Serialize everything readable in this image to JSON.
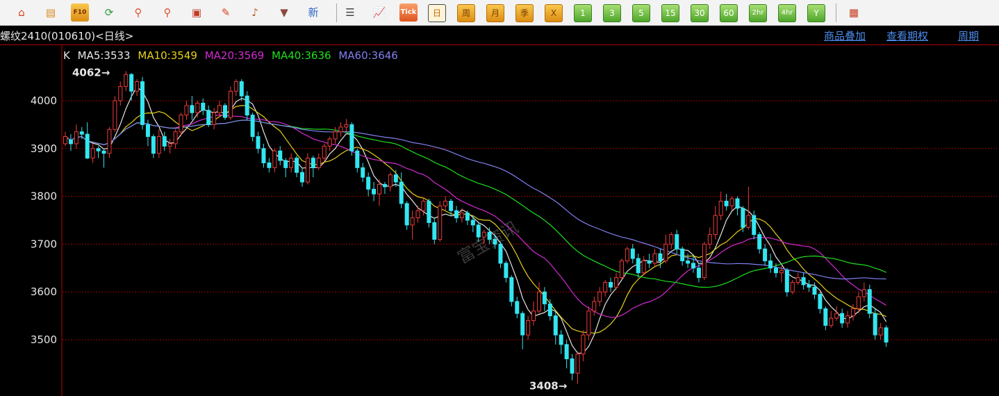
{
  "toolbar": {
    "tools": [
      {
        "icon": "home-icon",
        "glyph": "⌂",
        "color": "#d8411d"
      },
      {
        "icon": "notes-icon",
        "glyph": "▤",
        "color": "#d9871a"
      },
      {
        "icon": "f10-icon",
        "label": "F10"
      },
      {
        "icon": "refresh-icon",
        "glyph": "⟳",
        "color": "#2e9c3a"
      },
      {
        "icon": "zoom-in-icon",
        "glyph": "⚲",
        "color": "#e0512a"
      },
      {
        "icon": "zoom-out-icon",
        "glyph": "⚲",
        "color": "#e0512a"
      },
      {
        "icon": "windows-icon",
        "glyph": "▣",
        "color": "#c23a21"
      },
      {
        "icon": "pen-icon",
        "glyph": "✎",
        "color": "#d9421f"
      },
      {
        "icon": "bell-icon",
        "glyph": "♪",
        "color": "#b3602a"
      },
      {
        "icon": "filter-icon",
        "glyph": "▼",
        "color": "#8b4a3b"
      },
      {
        "icon": "news-icon",
        "label": "新",
        "color": "#2f66c5"
      }
    ],
    "tools2": [
      {
        "icon": "table-icon",
        "glyph": "☰",
        "color": "#444444"
      },
      {
        "icon": "line-chart-icon",
        "glyph": "📈",
        "color": "#c73a20"
      },
      {
        "icon": "tick-icon",
        "label": "Tick"
      }
    ],
    "periods": [
      {
        "label": "日",
        "style": "sel"
      },
      {
        "label": "周",
        "style": "amber"
      },
      {
        "label": "月",
        "style": "amber"
      },
      {
        "label": "季",
        "style": "amber"
      },
      {
        "label": "X",
        "style": "amber"
      },
      {
        "label": "1",
        "style": "green"
      },
      {
        "label": "3",
        "style": "green"
      },
      {
        "label": "5",
        "style": "green"
      },
      {
        "label": "15",
        "style": "green"
      },
      {
        "label": "30",
        "style": "green"
      },
      {
        "label": "60",
        "style": "green"
      },
      {
        "label": "2hr",
        "style": "green"
      },
      {
        "label": "4hr",
        "style": "green"
      },
      {
        "label": "Y",
        "style": "green"
      }
    ],
    "last_tool": {
      "icon": "grid-icon",
      "glyph": "▦",
      "color": "#c63a1c"
    }
  },
  "header": {
    "instrument": "螺纹2410(010610)<日线>",
    "links": [
      "商品叠加",
      "查看期权",
      "周期"
    ]
  },
  "legend": [
    {
      "label": "K",
      "color": "#e8e8e8"
    },
    {
      "label": "MA5:3533",
      "color": "#e8e8e8"
    },
    {
      "label": "MA10:3549",
      "color": "#e6d21a"
    },
    {
      "label": "MA20:3569",
      "color": "#d22bd2"
    },
    {
      "label": "MA40:3636",
      "color": "#1ee01e"
    },
    {
      "label": "MA60:3646",
      "color": "#8080f0"
    }
  ],
  "chart_data": {
    "type": "candlestick",
    "ylim": [
      3400,
      4100
    ],
    "yticks": [
      3500,
      3600,
      3700,
      3800,
      3900,
      4000
    ],
    "grid": true,
    "watermark": "富宝资讯",
    "annotations": [
      {
        "text": "4062→",
        "value": 4062
      },
      {
        "text": "3408→",
        "value": 3408
      }
    ],
    "up_color": "#f03c3c",
    "down_color": "#33e6f0",
    "candles": [
      [
        3910,
        3925,
        3935,
        3905
      ],
      [
        3918,
        3910,
        3930,
        3895
      ],
      [
        3910,
        3935,
        3950,
        3900
      ],
      [
        3935,
        3930,
        3945,
        3920
      ],
      [
        3930,
        3880,
        3955,
        3878
      ],
      [
        3880,
        3900,
        3910,
        3870
      ],
      [
        3900,
        3895,
        3905,
        3880
      ],
      [
        3895,
        3890,
        3900,
        3860
      ],
      [
        3890,
        3940,
        3945,
        3880
      ],
      [
        3940,
        4000,
        4010,
        3935
      ],
      [
        4000,
        4030,
        4040,
        3990
      ],
      [
        4030,
        4055,
        4062,
        4020
      ],
      [
        4055,
        4020,
        4058,
        4000
      ],
      [
        4020,
        4040,
        4045,
        4010
      ],
      [
        4040,
        3950,
        4050,
        3940
      ],
      [
        3950,
        3925,
        3960,
        3905
      ],
      [
        3925,
        3890,
        3930,
        3880
      ],
      [
        3890,
        3925,
        3940,
        3880
      ],
      [
        3925,
        3905,
        3935,
        3895
      ],
      [
        3905,
        3910,
        3920,
        3890
      ],
      [
        3910,
        3935,
        3940,
        3900
      ],
      [
        3935,
        3970,
        3975,
        3925
      ],
      [
        3970,
        3990,
        4000,
        3960
      ],
      [
        3990,
        3975,
        4010,
        3960
      ],
      [
        3975,
        3995,
        4000,
        3965
      ],
      [
        3995,
        3980,
        4005,
        3970
      ],
      [
        3980,
        3950,
        3990,
        3945
      ],
      [
        3950,
        3975,
        3985,
        3940
      ],
      [
        3975,
        3990,
        4000,
        3965
      ],
      [
        3990,
        3965,
        3995,
        3960
      ],
      [
        3965,
        4020,
        4030,
        3960
      ],
      [
        4020,
        4040,
        4045,
        4010
      ],
      [
        4040,
        4010,
        4045,
        4000
      ],
      [
        4010,
        3970,
        4020,
        3960
      ],
      [
        3970,
        3925,
        3975,
        3915
      ],
      [
        3925,
        3900,
        3935,
        3890
      ],
      [
        3900,
        3870,
        3910,
        3860
      ],
      [
        3870,
        3860,
        3880,
        3850
      ],
      [
        3860,
        3895,
        3900,
        3850
      ],
      [
        3895,
        3875,
        3905,
        3865
      ],
      [
        3875,
        3860,
        3880,
        3840
      ],
      [
        3860,
        3880,
        3890,
        3850
      ],
      [
        3880,
        3850,
        3885,
        3840
      ],
      [
        3850,
        3830,
        3860,
        3820
      ],
      [
        3830,
        3880,
        3890,
        3825
      ],
      [
        3880,
        3860,
        3885,
        3840
      ],
      [
        3860,
        3880,
        3890,
        3855
      ],
      [
        3880,
        3905,
        3910,
        3870
      ],
      [
        3905,
        3920,
        3925,
        3895
      ],
      [
        3920,
        3935,
        3945,
        3910
      ],
      [
        3935,
        3945,
        3955,
        3925
      ],
      [
        3945,
        3950,
        3962,
        3935
      ],
      [
        3950,
        3895,
        3955,
        3885
      ],
      [
        3895,
        3860,
        3900,
        3850
      ],
      [
        3860,
        3840,
        3870,
        3830
      ],
      [
        3840,
        3815,
        3850,
        3800
      ],
      [
        3815,
        3805,
        3830,
        3790
      ],
      [
        3805,
        3825,
        3835,
        3780
      ],
      [
        3825,
        3820,
        3830,
        3805
      ],
      [
        3820,
        3845,
        3850,
        3810
      ],
      [
        3845,
        3830,
        3855,
        3820
      ],
      [
        3830,
        3785,
        3850,
        3775
      ],
      [
        3785,
        3740,
        3790,
        3730
      ],
      [
        3740,
        3755,
        3770,
        3710
      ],
      [
        3755,
        3770,
        3780,
        3745
      ],
      [
        3770,
        3790,
        3795,
        3760
      ],
      [
        3790,
        3745,
        3795,
        3735
      ],
      [
        3745,
        3710,
        3755,
        3700
      ],
      [
        3710,
        3780,
        3790,
        3705
      ],
      [
        3780,
        3790,
        3800,
        3770
      ],
      [
        3790,
        3770,
        3795,
        3760
      ],
      [
        3770,
        3755,
        3780,
        3745
      ],
      [
        3755,
        3765,
        3775,
        3745
      ],
      [
        3765,
        3750,
        3770,
        3740
      ],
      [
        3750,
        3740,
        3760,
        3725
      ],
      [
        3740,
        3715,
        3745,
        3705
      ],
      [
        3715,
        3725,
        3730,
        3700
      ],
      [
        3725,
        3710,
        3735,
        3700
      ],
      [
        3710,
        3700,
        3720,
        3690
      ],
      [
        3700,
        3660,
        3705,
        3650
      ],
      [
        3660,
        3630,
        3665,
        3620
      ],
      [
        3630,
        3580,
        3635,
        3570
      ],
      [
        3580,
        3555,
        3590,
        3545
      ],
      [
        3555,
        3510,
        3560,
        3480
      ],
      [
        3510,
        3540,
        3550,
        3500
      ],
      [
        3540,
        3560,
        3580,
        3530
      ],
      [
        3560,
        3600,
        3620,
        3555
      ],
      [
        3600,
        3575,
        3610,
        3560
      ],
      [
        3575,
        3550,
        3585,
        3540
      ],
      [
        3550,
        3510,
        3560,
        3490
      ],
      [
        3510,
        3490,
        3520,
        3470
      ],
      [
        3490,
        3460,
        3500,
        3440
      ],
      [
        3460,
        3430,
        3470,
        3415
      ],
      [
        3430,
        3470,
        3475,
        3408
      ],
      [
        3470,
        3510,
        3520,
        3455
      ],
      [
        3510,
        3560,
        3570,
        3500
      ],
      [
        3560,
        3580,
        3590,
        3550
      ],
      [
        3580,
        3600,
        3610,
        3570
      ],
      [
        3600,
        3620,
        3625,
        3590
      ],
      [
        3620,
        3610,
        3630,
        3600
      ],
      [
        3610,
        3630,
        3640,
        3605
      ],
      [
        3630,
        3665,
        3670,
        3625
      ],
      [
        3665,
        3690,
        3695,
        3660
      ],
      [
        3690,
        3670,
        3700,
        3660
      ],
      [
        3670,
        3640,
        3680,
        3630
      ],
      [
        3640,
        3665,
        3675,
        3635
      ],
      [
        3665,
        3660,
        3680,
        3650
      ],
      [
        3660,
        3680,
        3690,
        3655
      ],
      [
        3680,
        3665,
        3690,
        3650
      ],
      [
        3665,
        3700,
        3720,
        3660
      ],
      [
        3700,
        3720,
        3725,
        3690
      ],
      [
        3720,
        3690,
        3730,
        3680
      ],
      [
        3690,
        3665,
        3695,
        3655
      ],
      [
        3665,
        3660,
        3680,
        3650
      ],
      [
        3660,
        3650,
        3675,
        3640
      ],
      [
        3650,
        3630,
        3660,
        3620
      ],
      [
        3630,
        3700,
        3705,
        3625
      ],
      [
        3700,
        3720,
        3735,
        3690
      ],
      [
        3720,
        3760,
        3780,
        3710
      ],
      [
        3760,
        3790,
        3810,
        3750
      ],
      [
        3790,
        3780,
        3805,
        3770
      ],
      [
        3780,
        3795,
        3800,
        3770
      ],
      [
        3795,
        3775,
        3800,
        3760
      ],
      [
        3775,
        3735,
        3780,
        3725
      ],
      [
        3735,
        3760,
        3820,
        3730
      ],
      [
        3760,
        3720,
        3770,
        3710
      ],
      [
        3720,
        3690,
        3725,
        3680
      ],
      [
        3690,
        3665,
        3700,
        3655
      ],
      [
        3665,
        3650,
        3680,
        3640
      ],
      [
        3650,
        3640,
        3660,
        3630
      ],
      [
        3640,
        3645,
        3655,
        3620
      ],
      [
        3645,
        3600,
        3650,
        3590
      ],
      [
        3600,
        3620,
        3625,
        3595
      ],
      [
        3620,
        3630,
        3640,
        3615
      ],
      [
        3630,
        3615,
        3640,
        3605
      ],
      [
        3615,
        3610,
        3625,
        3600
      ],
      [
        3610,
        3595,
        3620,
        3585
      ],
      [
        3595,
        3565,
        3600,
        3555
      ],
      [
        3565,
        3530,
        3570,
        3520
      ],
      [
        3530,
        3545,
        3560,
        3525
      ],
      [
        3545,
        3555,
        3570,
        3540
      ],
      [
        3555,
        3535,
        3565,
        3525
      ],
      [
        3535,
        3550,
        3560,
        3525
      ],
      [
        3550,
        3565,
        3575,
        3540
      ],
      [
        3565,
        3590,
        3600,
        3555
      ],
      [
        3590,
        3605,
        3620,
        3580
      ],
      [
        3605,
        3555,
        3615,
        3545
      ],
      [
        3555,
        3510,
        3565,
        3500
      ],
      [
        3510,
        3525,
        3535,
        3500
      ],
      [
        3525,
        3495,
        3530,
        3485
      ]
    ]
  }
}
